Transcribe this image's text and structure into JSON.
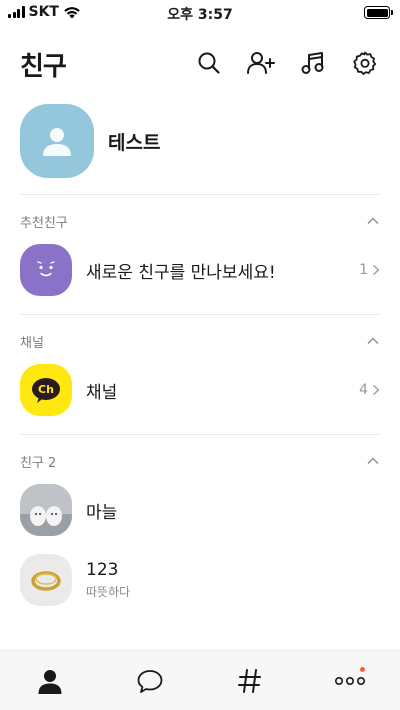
{
  "status": {
    "carrier": "SKT",
    "time": "오후 3:57"
  },
  "header": {
    "title": "친구"
  },
  "profile": {
    "name": "테스트"
  },
  "sections": {
    "recommended": {
      "title": "추천친구",
      "item_label": "새로운 친구를 만나보세요!",
      "count": "1"
    },
    "channel": {
      "title": "채널",
      "item_label": "채널",
      "count": "4"
    },
    "friends": {
      "title": "친구 2",
      "items": [
        {
          "name": "마늘",
          "status": ""
        },
        {
          "name": "123",
          "status": "따뜻하다"
        }
      ]
    }
  },
  "tabs": [
    "friends-tab",
    "chats-tab",
    "openchat-tab",
    "more-tab"
  ],
  "colors": {
    "profile_avatar": "#94c7dc",
    "recommend_avatar": "#8a72c9",
    "channel_avatar": "#ffe812",
    "badge": "#ff5c3e"
  }
}
